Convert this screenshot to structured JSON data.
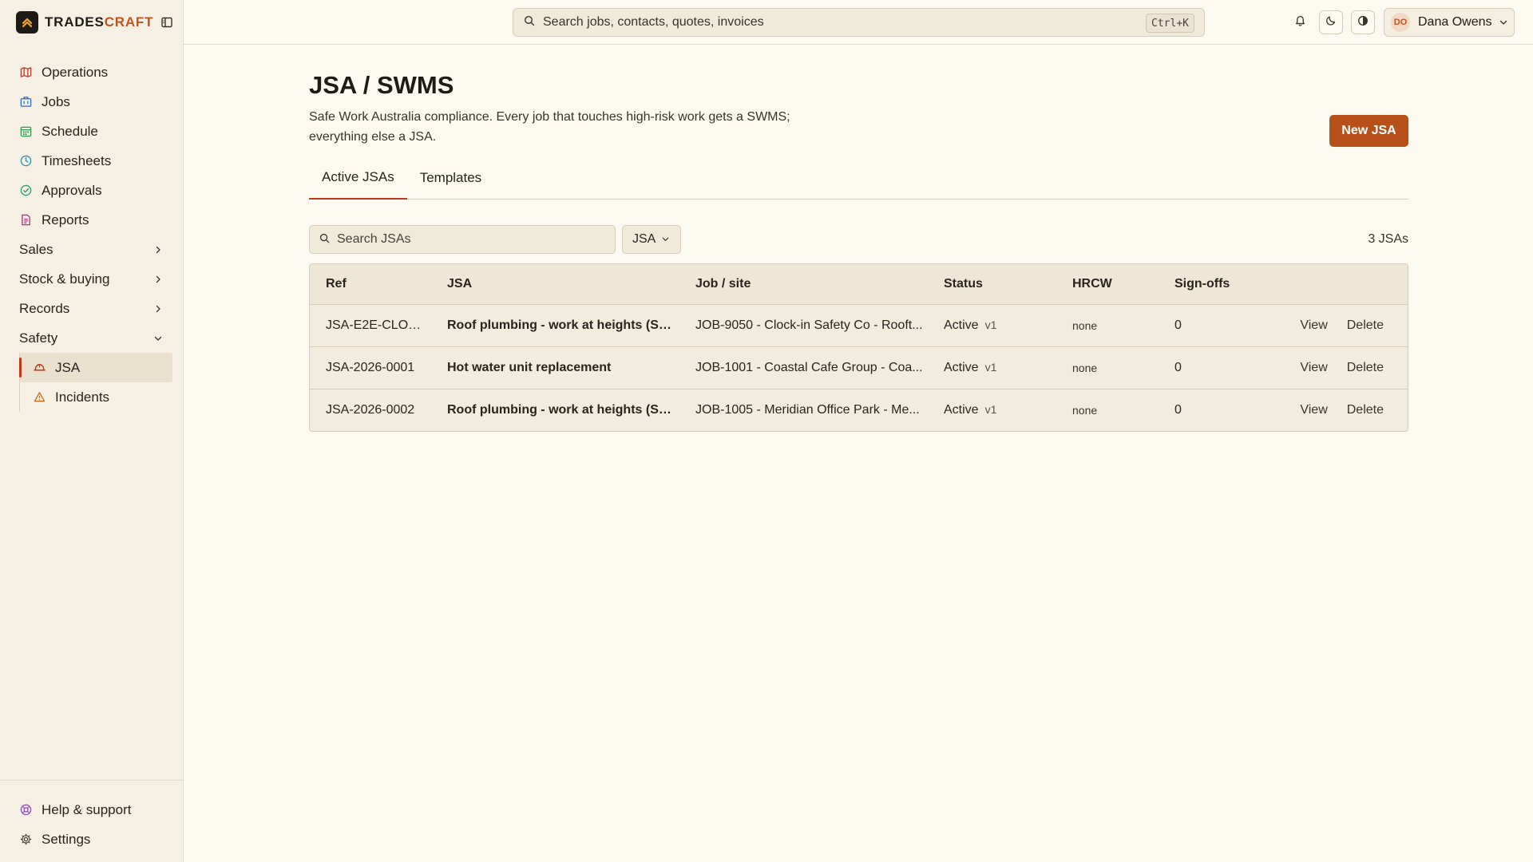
{
  "brand": {
    "prefix": "TRADES",
    "suffix": "CRAFT"
  },
  "colors": {
    "accent": "#b8501a",
    "active_marker": "#c2361a",
    "background": "#fcf9f1",
    "sidebar": "#f5f0e3"
  },
  "sidebar": {
    "items": [
      {
        "label": "Operations",
        "icon": "map-icon"
      },
      {
        "label": "Jobs",
        "icon": "building-icon"
      },
      {
        "label": "Schedule",
        "icon": "calendar-icon"
      },
      {
        "label": "Timesheets",
        "icon": "clock-icon"
      },
      {
        "label": "Approvals",
        "icon": "check-circle-icon"
      },
      {
        "label": "Reports",
        "icon": "document-icon"
      }
    ],
    "groups": [
      {
        "label": "Sales"
      },
      {
        "label": "Stock & buying"
      },
      {
        "label": "Records"
      },
      {
        "label": "Safety"
      }
    ],
    "safety_items": [
      {
        "label": "JSA",
        "icon": "hard-hat-icon"
      },
      {
        "label": "Incidents",
        "icon": "warning-icon"
      }
    ],
    "footer": [
      {
        "label": "Help & support",
        "icon": "lifebuoy-icon"
      },
      {
        "label": "Settings",
        "icon": "gear-icon"
      }
    ]
  },
  "topbar": {
    "search_placeholder": "Search jobs, contacts, quotes, invoices",
    "shortcut": "Ctrl+K",
    "user": {
      "initials": "DO",
      "name": "Dana Owens"
    }
  },
  "page": {
    "title": "JSA / SWMS",
    "description": "Safe Work Australia compliance. Every job that touches high-risk work gets a SWMS; everything else a JSA.",
    "new_button": "New JSA",
    "tabs": [
      "Active JSAs",
      "Templates"
    ],
    "search_placeholder": "Search JSAs",
    "filter": "JSA",
    "count": "3 JSAs"
  },
  "table": {
    "headers": {
      "ref": "Ref",
      "jsa": "JSA",
      "job": "Job / site",
      "status": "Status",
      "hrcw": "HRCW",
      "signoffs": "Sign-offs"
    },
    "rows": [
      {
        "ref": "JSA-E2E-CLOC...",
        "jsa": "Roof plumbing - work at heights (SW...",
        "job": "JOB-9050 - Clock-in Safety Co - Rooft...",
        "status": "Active",
        "version": "v1",
        "hrcw": "none",
        "signoffs": "0",
        "view": "View",
        "delete": "Delete"
      },
      {
        "ref": "JSA-2026-0001",
        "jsa": "Hot water unit replacement",
        "job": "JOB-1001 - Coastal Cafe Group - Coa...",
        "status": "Active",
        "version": "v1",
        "hrcw": "none",
        "signoffs": "0",
        "view": "View",
        "delete": "Delete"
      },
      {
        "ref": "JSA-2026-0002",
        "jsa": "Roof plumbing - work at heights (SW...",
        "job": "JOB-1005 - Meridian Office Park - Me...",
        "status": "Active",
        "version": "v1",
        "hrcw": "none",
        "signoffs": "0",
        "view": "View",
        "delete": "Delete"
      }
    ]
  }
}
